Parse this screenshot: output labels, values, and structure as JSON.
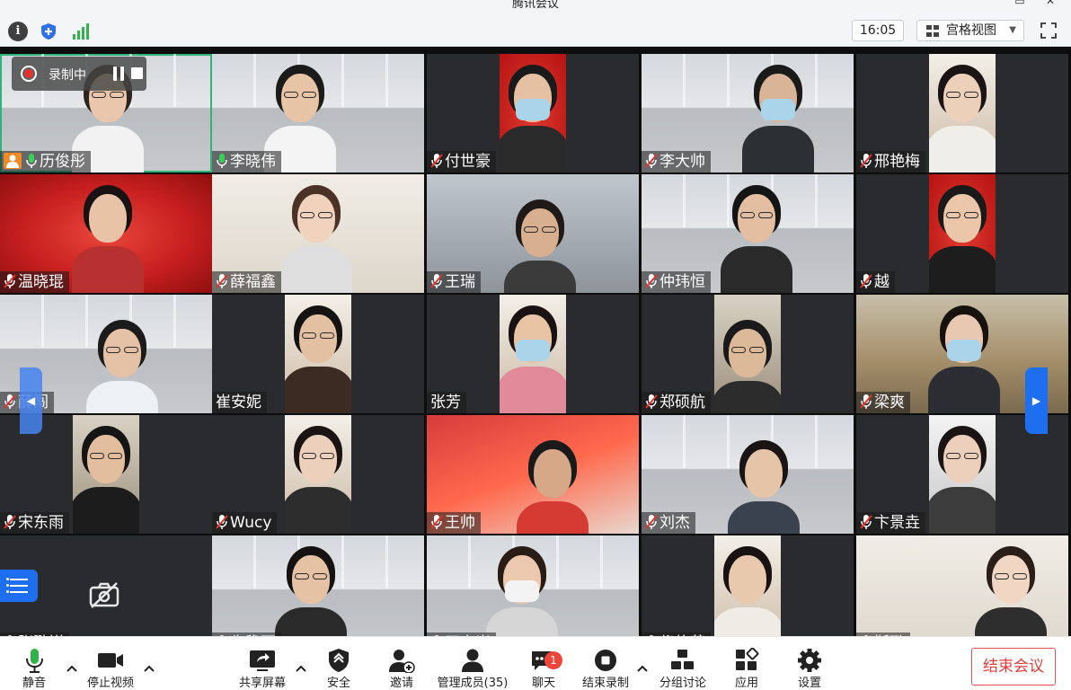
{
  "window": {
    "title": "腾讯会议"
  },
  "topbar": {
    "time": "16:05",
    "view_label": "宫格视图"
  },
  "recording": {
    "label": "录制中"
  },
  "participants": [
    {
      "name": "历俊彤",
      "mic": "on"
    },
    {
      "name": "李晓伟",
      "mic": "on"
    },
    {
      "name": "付世豪",
      "mic": "muted"
    },
    {
      "name": "李大帅",
      "mic": "muted"
    },
    {
      "name": "邢艳梅",
      "mic": "muted"
    },
    {
      "name": "温晓琨",
      "mic": "muted"
    },
    {
      "name": "薛福鑫",
      "mic": "muted"
    },
    {
      "name": "王瑞",
      "mic": "muted"
    },
    {
      "name": "仲玮恒",
      "mic": "muted"
    },
    {
      "name": "越",
      "mic": "muted"
    },
    {
      "name": "薛闯",
      "mic": "muted"
    },
    {
      "name": "崔安妮",
      "mic": "none"
    },
    {
      "name": "张芳",
      "mic": "none"
    },
    {
      "name": "郑硕航",
      "mic": "muted"
    },
    {
      "name": "梁爽",
      "mic": "muted"
    },
    {
      "name": "宋东雨",
      "mic": "muted"
    },
    {
      "name": "Wucy",
      "mic": "muted"
    },
    {
      "name": "王帅",
      "mic": "muted"
    },
    {
      "name": "刘杰",
      "mic": "muted"
    },
    {
      "name": "卞景垚",
      "mic": "muted"
    },
    {
      "name": "张鹏祥",
      "mic": "muted"
    },
    {
      "name": "朱稳丽",
      "mic": "muted"
    },
    {
      "name": "王文岩",
      "mic": "muted"
    },
    {
      "name": "倪艳萍",
      "mic": "muted"
    },
    {
      "name": "靳璐",
      "mic": "muted"
    }
  ],
  "toolbar": {
    "mute": "静音",
    "stop_video": "停止视频",
    "share_screen": "共享屏幕",
    "security": "安全",
    "invite": "邀请",
    "manage_members": "管理成员(35)",
    "chat": "聊天",
    "chat_badge": "1",
    "end_recording": "结束录制",
    "breakout": "分组讨论",
    "apps": "应用",
    "settings": "设置",
    "end_meeting": "结束会议"
  },
  "colors": {
    "accent": "#1e6ef0",
    "speaker": "#2fb37a",
    "danger": "#e23b3b",
    "record": "#e5322d"
  }
}
